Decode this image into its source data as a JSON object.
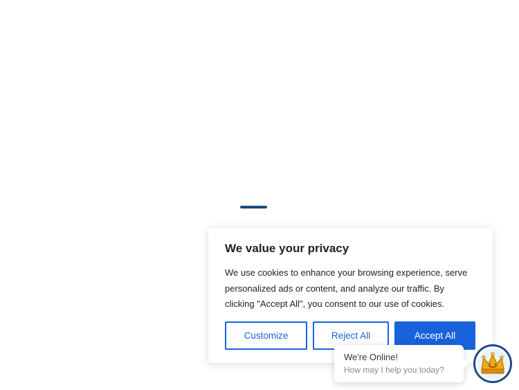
{
  "colors": {
    "primary": "#1863dc",
    "loader": "#1a4b7c",
    "avatar_ring": "#1c4a8a",
    "crown_gold": "#f2a916"
  },
  "cookie_banner": {
    "title": "We value your privacy",
    "text": "We use cookies to enhance your browsing experience, serve personalized ads or content, and analyze our traffic. By clicking \"Accept All\", you consent to our use of cookies.",
    "customize_label": "Customize",
    "reject_label": "Reject All",
    "accept_label": "Accept All"
  },
  "chat_widget": {
    "title": "We're Online!",
    "subtitle": "How may I help you today?",
    "avatar_icon": "crown-icon"
  }
}
